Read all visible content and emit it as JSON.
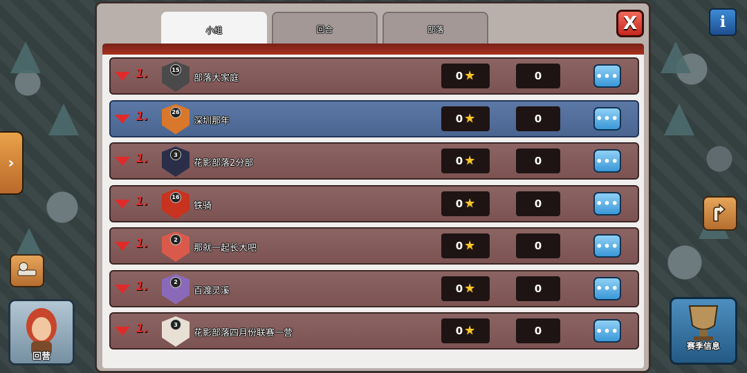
{
  "tabs": [
    {
      "label": "小组",
      "active": true
    },
    {
      "label": "回合",
      "active": false
    },
    {
      "label": "部落",
      "active": false
    }
  ],
  "close_icon": "X",
  "info_icon": "i",
  "home_label": "回营",
  "season_label": "赛季信息",
  "rows": [
    {
      "rank": "1.",
      "clan": "部落大家庭",
      "badge_level": "15",
      "stars": "0",
      "damage": "0",
      "badge_color": "#4a4a4a",
      "highlight": false
    },
    {
      "rank": "1.",
      "clan": "深圳那年",
      "badge_level": "26",
      "stars": "0",
      "damage": "0",
      "badge_color": "#d9772a",
      "highlight": true
    },
    {
      "rank": "1.",
      "clan": "花影部落2分部",
      "badge_level": "3",
      "stars": "0",
      "damage": "0",
      "badge_color": "#2b2e48",
      "highlight": false
    },
    {
      "rank": "1.",
      "clan": "铁骑",
      "badge_level": "16",
      "stars": "0",
      "damage": "0",
      "badge_color": "#c7331f",
      "highlight": false
    },
    {
      "rank": "1.",
      "clan": "那就一起长大吧",
      "badge_level": "2",
      "stars": "0",
      "damage": "0",
      "badge_color": "#d95a4a",
      "highlight": false
    },
    {
      "rank": "1.",
      "clan": "百渡灵溪",
      "badge_level": "2",
      "stars": "0",
      "damage": "0",
      "badge_color": "#8a6ab8",
      "highlight": false
    },
    {
      "rank": "1.",
      "clan": "花影部落四月份联赛一营",
      "badge_level": "3",
      "stars": "0",
      "damage": "0",
      "badge_color": "#e8e0d4",
      "highlight": false
    }
  ],
  "more_label": "•••",
  "star_glyph": "★"
}
